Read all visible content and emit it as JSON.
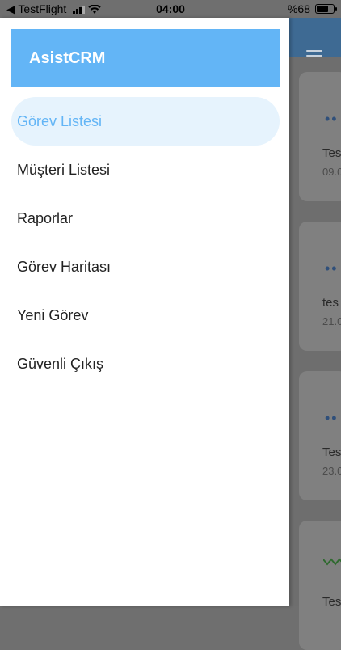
{
  "status_bar": {
    "back_label": "◀ TestFlight",
    "time": "04:00",
    "battery": "%68"
  },
  "drawer": {
    "title": "AsistCRM",
    "items": [
      {
        "label": "Görev Listesi",
        "active": true
      },
      {
        "label": "Müşteri Listesi"
      },
      {
        "label": "Raporlar"
      },
      {
        "label": "Görev Haritası"
      },
      {
        "label": "Yeni Görev"
      },
      {
        "label": "Güvenli Çıkış"
      }
    ]
  },
  "background_cards": [
    {
      "text": "Tes",
      "date": "09.0"
    },
    {
      "text": "tes",
      "date": "21.0"
    },
    {
      "text": "Tes",
      "date": "23.0"
    },
    {
      "text": "Tes",
      "date": ""
    }
  ],
  "colors": {
    "accent": "#63b5f6",
    "active_bg": "#e6f3fd"
  }
}
